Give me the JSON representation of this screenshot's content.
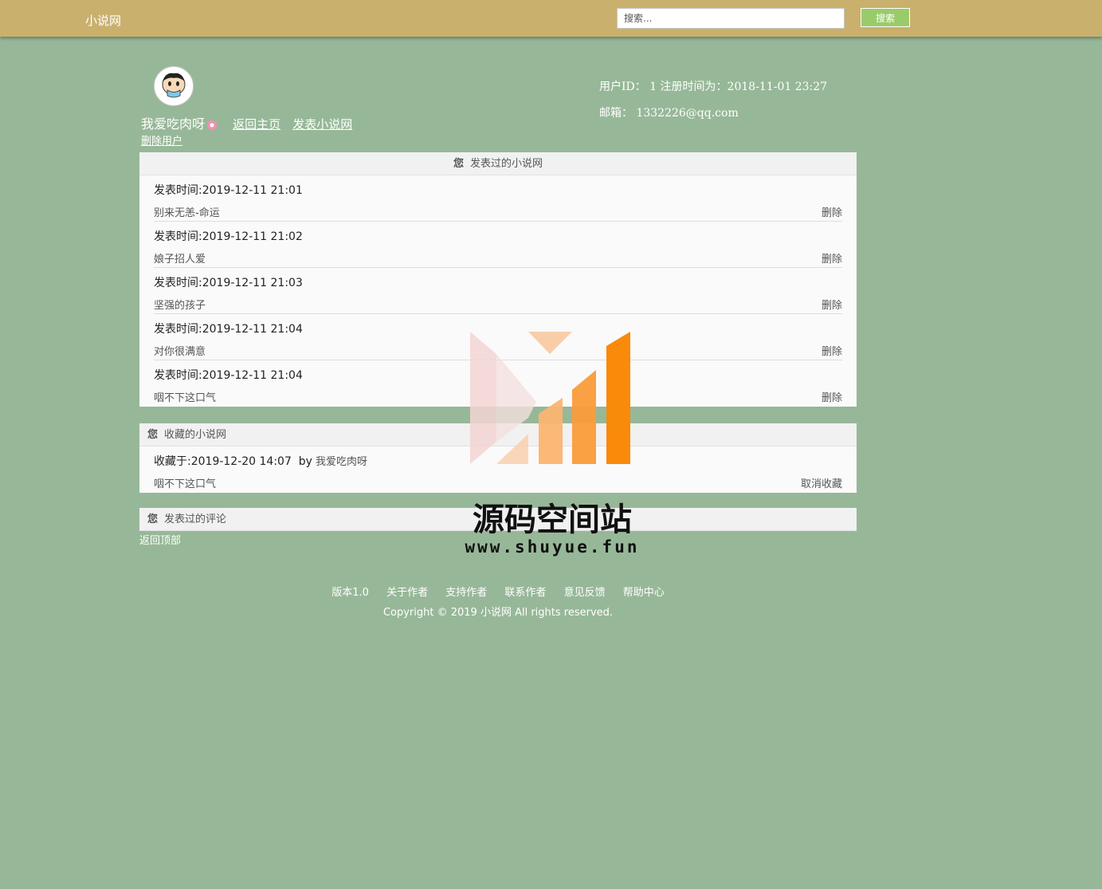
{
  "header": {
    "brand": "小说网",
    "search_placeholder": "搜索...",
    "search_button": "搜索"
  },
  "profile": {
    "username": "我爱吃肉呀",
    "back_home": "返回主页",
    "publish_novel": "发表小说网",
    "delete_user": "删除用户",
    "user_id_line": "用户ID： 1    注册时间为：2018-11-01 23:27",
    "email_line": "邮箱：  1332226@qq.com"
  },
  "published_panel": {
    "header_you": "您",
    "header_title": "发表过的小说网",
    "items": [
      {
        "time": "发表时间:2019-12-11 21:01",
        "title": "别来无恙-命运",
        "action": "删除"
      },
      {
        "time": "发表时间:2019-12-11 21:02",
        "title": "娘子招人爱",
        "action": "删除"
      },
      {
        "time": "发表时间:2019-12-11 21:03",
        "title": "坚强的孩子",
        "action": "删除"
      },
      {
        "time": "发表时间:2019-12-11 21:04",
        "title": "对你很满意",
        "action": "删除"
      },
      {
        "time": "发表时间:2019-12-11 21:04",
        "title": "咽不下这口气",
        "action": "删除"
      }
    ]
  },
  "favorites_panel": {
    "header_you": "您",
    "header_title": "收藏的小说网",
    "items": [
      {
        "time": "收藏于:2019-12-20 14:07",
        "by": "by",
        "author": "我爱吃肉呀",
        "title": "咽不下这口气",
        "action": "取消收藏"
      }
    ]
  },
  "comments_panel": {
    "header_you": "您",
    "header_title": "发表过的评论"
  },
  "back_to_top": "返回顶部",
  "footer": {
    "links": [
      "版本1.0",
      "关于作者",
      "支持作者",
      "联系作者",
      "意见反馈",
      "帮助中心"
    ],
    "copyright": "Copyright © 2019 小说网 All rights reserved."
  },
  "watermark": {
    "name": "源码空间站",
    "url": "www.shuyue.fun"
  },
  "colors": {
    "background": "#97b898",
    "topbar": "#c9b06d",
    "search_button": "#9acb6a",
    "panel": "#fafafa"
  }
}
